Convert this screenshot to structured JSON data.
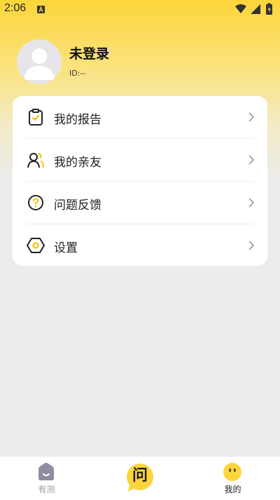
{
  "status_bar": {
    "time": "2:06"
  },
  "profile": {
    "name": "未登录",
    "id_text": "ID:--"
  },
  "menu": {
    "items": [
      {
        "label": "我的报告",
        "icon": "clipboard-check-icon"
      },
      {
        "label": "我的亲友",
        "icon": "users-icon"
      },
      {
        "label": "问题反馈",
        "icon": "question-circle-icon"
      },
      {
        "label": "设置",
        "icon": "hexagon-gear-icon"
      }
    ]
  },
  "tab_bar": {
    "tabs": [
      {
        "label": "有测",
        "icon": "home-smile-icon",
        "active": false
      },
      {
        "label": "问",
        "icon": "chat-bubble-icon",
        "active": false
      },
      {
        "label": "我的",
        "icon": "face-icon",
        "active": true
      }
    ]
  },
  "colors": {
    "accent": "#fcd53a",
    "accent_dark": "#f5c400",
    "inactive_tab": "#9a9aa8",
    "background": "#ececec"
  }
}
